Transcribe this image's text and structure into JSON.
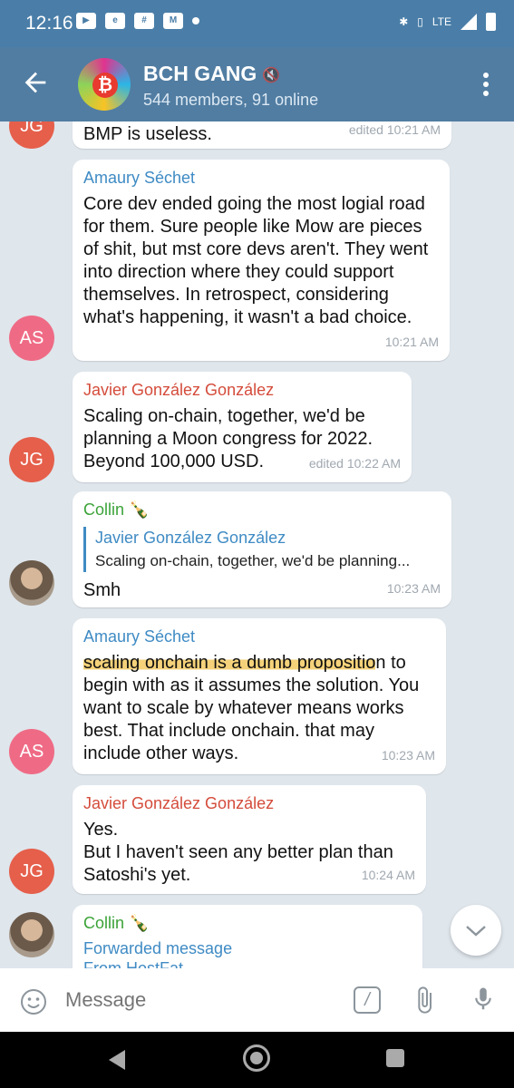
{
  "status_bar": {
    "time": "12:16",
    "network": "LTE"
  },
  "header": {
    "group_name": "BCH GANG",
    "subtitle": "544 members, 91 online"
  },
  "messages": [
    {
      "text": "BMP is useless.",
      "time": "edited 10:21 AM",
      "avatar": "JG"
    },
    {
      "sender": "Amaury Séchet",
      "text": "Core dev ended going the most logial road for them. Sure people like Mow are pieces of shit, but mst core devs aren't. They went into direction where they could support themselves. In retrospect, considering what's happening, it wasn't a bad choice.",
      "time": "10:21 AM",
      "avatar": "AS"
    },
    {
      "sender": "Javier González González",
      "text": "Scaling on-chain, together, we'd be planning a Moon congress for 2022. Beyond 100,000 USD.",
      "time": "edited 10:22 AM",
      "avatar": "JG"
    },
    {
      "sender": "Collin 🍾",
      "reply_name": "Javier González González",
      "reply_text": "Scaling on-chain, together, we'd be planning...",
      "text": "Smh",
      "time": "10:23 AM"
    },
    {
      "sender": "Amaury Séchet",
      "text_highlight": "scaling onchain is a dumb propositio",
      "text_rest": "n to begin with as it assumes the solution. You want to scale by whatever means works best. That include onchain. that may include other ways.",
      "time": "10:23 AM",
      "avatar": "AS"
    },
    {
      "sender": "Javier González González",
      "text_line1": "Yes.",
      "text_line2": "But I haven't seen any better plan than Satoshi's yet.",
      "time": "10:24 AM",
      "avatar": "JG"
    },
    {
      "sender": "Collin 🍾",
      "forward_label": "Forwarded message",
      "forward_from": "From HostFat"
    }
  ],
  "input": {
    "placeholder": "Message"
  },
  "colors": {
    "header": "#517da2",
    "status_bar": "#4a7ea8",
    "sender_blue": "#3f8bc4",
    "sender_red": "#d44c3b",
    "sender_green": "#3ba338"
  }
}
